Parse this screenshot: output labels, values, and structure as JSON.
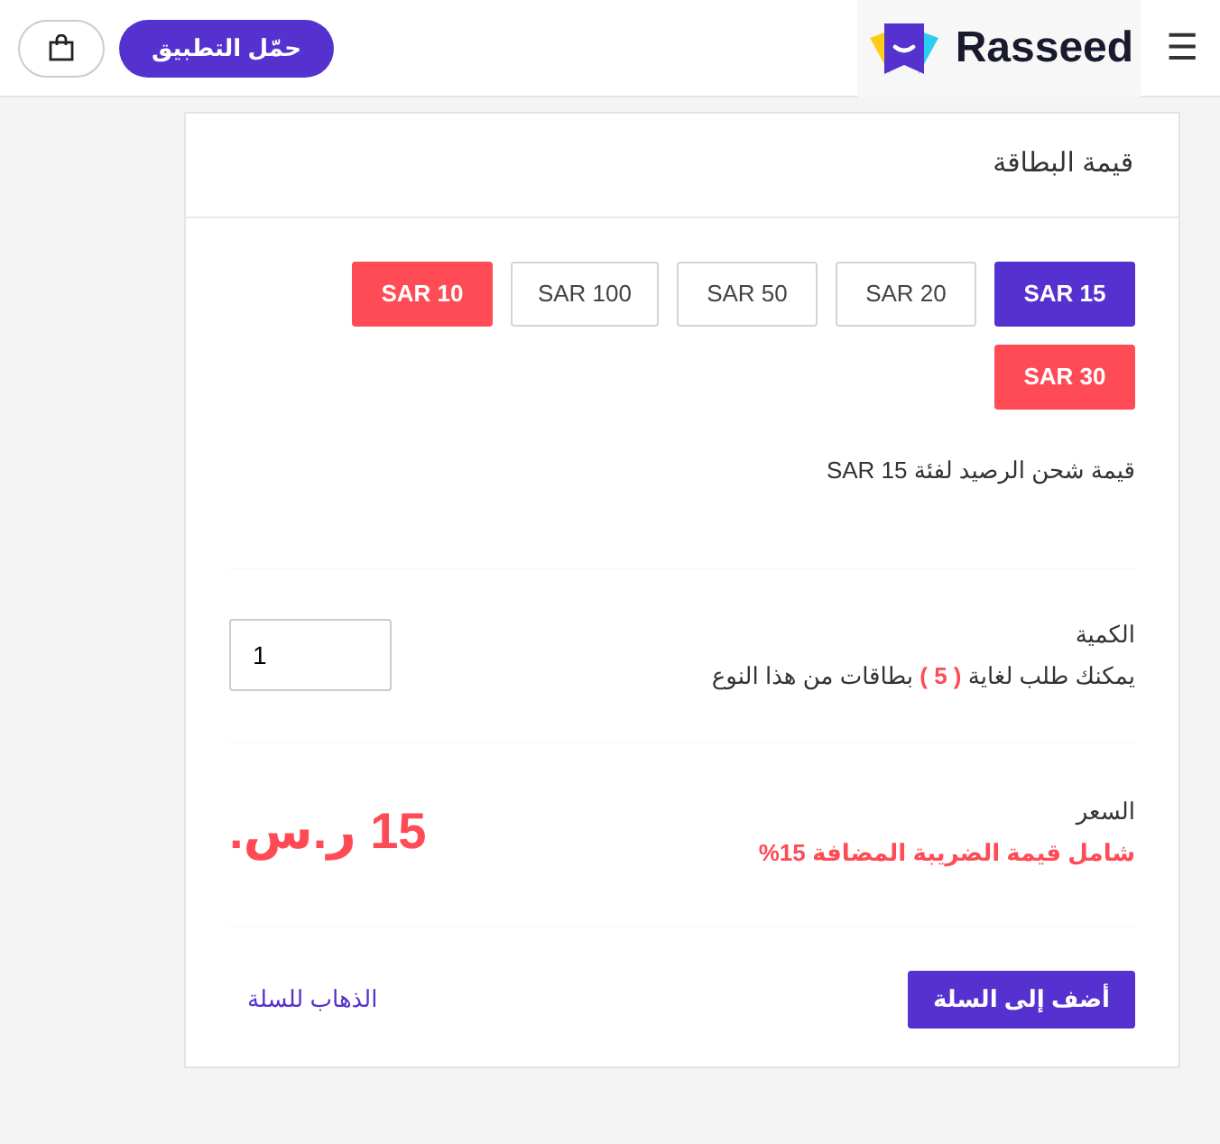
{
  "header": {
    "brand": "Rasseed",
    "menu_glyph": "☰",
    "download_button": "حمّل التطبيق"
  },
  "card": {
    "title": "قيمة البطاقة",
    "denominations": [
      {
        "label": "SAR 15",
        "selected": true,
        "kind": "available"
      },
      {
        "label": "SAR 20",
        "selected": false,
        "kind": "available"
      },
      {
        "label": "SAR 50",
        "selected": false,
        "kind": "available"
      },
      {
        "label": "SAR 100",
        "selected": false,
        "kind": "available"
      },
      {
        "label": "SAR 10",
        "selected": false,
        "kind": "unavailable"
      },
      {
        "label": "SAR 30",
        "selected": false,
        "kind": "unavailable"
      }
    ],
    "denomination_note": "قيمة شحن الرصيد لفئة SAR 15",
    "quantity": {
      "label": "الكمية",
      "limit_before": "يمكنك طلب لغاية",
      "limit_value": "( 5 )",
      "limit_after": "بطاقات من هذا النوع",
      "value": "1"
    },
    "price": {
      "label": "السعر",
      "tax_note": "شامل قيمة الضريبة المضافة 15%",
      "amount": "15 ر.س."
    },
    "add_to_cart": "أضف إلى السلة",
    "go_to_cart": "الذهاب للسلة"
  }
}
